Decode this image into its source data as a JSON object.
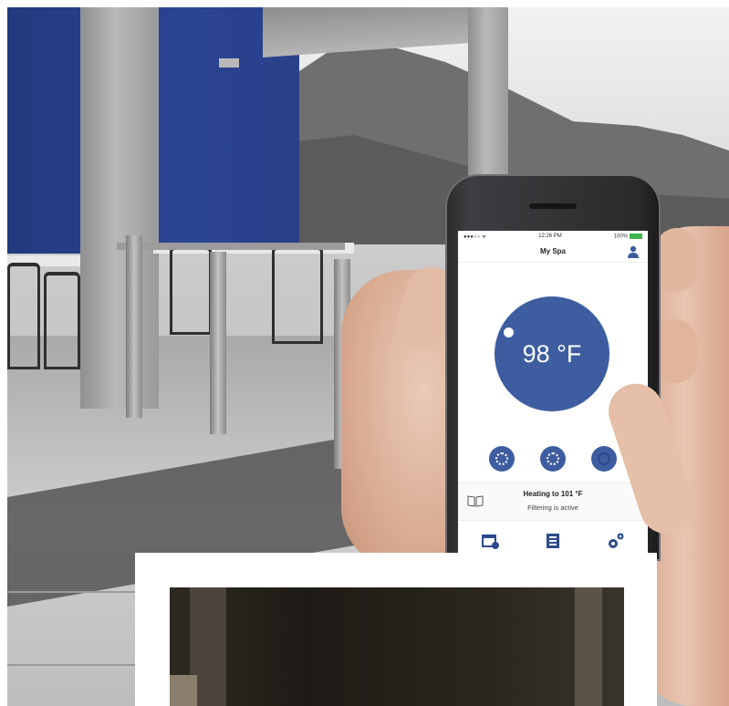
{
  "phone_app": {
    "status_bar": {
      "signal": "●●●○○ ᯤ",
      "time": "12:26 PM",
      "battery": "100%"
    },
    "nav_title": "My Spa",
    "temperature": "98 °F",
    "status": {
      "title": "Heating to 101 °F",
      "subtitle": "Filtering is active"
    }
  },
  "colors": {
    "accent_blue": "#3d5da0",
    "battery_green": "#3fb44a",
    "wall_blue": "#2b4492"
  },
  "icons": [
    "user-icon",
    "pump-icon",
    "jets-icon",
    "light-icon",
    "book-icon",
    "chevron-right-icon",
    "schedule-icon",
    "list-icon",
    "settings-icon"
  ]
}
